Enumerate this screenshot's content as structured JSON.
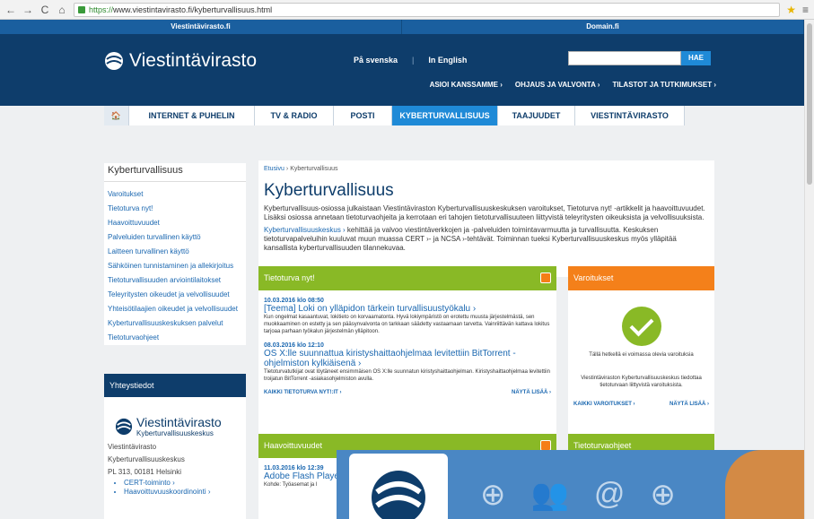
{
  "browser": {
    "url_https": "https://",
    "url_rest": "www.viestintavirasto.fi/kyberturvallisuus.html"
  },
  "toplinks": [
    "Viestintävirasto.fi",
    "Domain.fi"
  ],
  "header": {
    "logo": "Viestintävirasto",
    "lang_sv": "På svenska",
    "lang_en": "In English",
    "search_button": "HAE",
    "quick": [
      "ASIOI KANSSAMME ›",
      "OHJAUS JA VALVONTA ›",
      "TILASTOT JA TUTKIMUKSET ›"
    ]
  },
  "nav": [
    "INTERNET & PUHELIN",
    "TV & RADIO",
    "POSTI",
    "KYBERTURVALLISUUS",
    "TAAJUUDET",
    "VIESTINTÄVIRASTO"
  ],
  "sidebar": {
    "title": "Kyberturvallisuus",
    "items": [
      "Varoitukset",
      "Tietoturva nyt!",
      "Haavoittuvuudet",
      "Palveluiden turvallinen käyttö",
      "Laitteen turvallinen käyttö",
      "Sähköinen tunnistaminen ja allekirjoitus",
      "Tietoturvallisuuden arviointilaitokset",
      "Teleyritysten oikeudet ja velvollisuudet",
      "Yhteisötilaajien oikeudet ja velvollisuudet",
      "Kyberturvallisuuskeskuksen palvelut",
      "Tietoturvaohjeet"
    ]
  },
  "contact": {
    "title": "Yhteystiedot",
    "logo": "Viestintävirasto",
    "logo_sub": "Kyberturvallisuuskeskus",
    "line1": "Viestintävirasto",
    "line2": "Kyberturvallisuuskeskus",
    "line3": "PL 313, 00181 Helsinki",
    "links": [
      "CERT-toiminto ›",
      "Haavoittuvuuskoordinointi ›"
    ]
  },
  "main": {
    "crumb_home": "Etusivu",
    "crumb_current": "› Kyberturvallisuus",
    "title": "Kyberturvallisuus",
    "p1": "Kyberturvallisuus-osiossa julkaistaan Viestintäviraston Kyberturvallisuuskeskuksen varoitukset, Tietoturva nyt! -artikkelit ja haavoittuvuudet. Lisäksi osiossa annetaan tietoturvaohjeita ja kerrotaan eri tahojen tietoturvallisuuteen liittyvistä teleyritysten oikeuksista ja velvollisuuksista.",
    "p2_link": "Kyberturvallisuuskeskus ›",
    "p2": " kehittää ja valvoo viestintäverkkojen ja -palveluiden toimintavarmuutta ja turvallisuutta. Keskuksen tietoturvapalveluihin kuuluvat muun muassa CERT ›- ja NCSA ›-tehtävät. Toiminnan tueksi Kyberturvallisuuskeskus myös ylläpitää kansallista kyberturvallisuuden tilannekuvaa."
  },
  "news": {
    "title": "Tietoturva nyt!",
    "items": [
      {
        "date": "10.03.2016 klo 08:50",
        "title": "[Teema] Loki on ylläpidon tärkein turvallisuustyökalu ›",
        "desc": "Kun ongelmat kasaantuvat, lokitieto on korvaamatonta. Hyvä lokiympäristö on erotettu muusta järjestelmästä, sen muokkaaminen on estetty ja sen pääsynvalvonta on tarkkaan säädetty vastaamaan tarvetta. Vainriittävän kattava lokitus tarjoaa parhaan työkalun järjestelmän ylläpitoon."
      },
      {
        "date": "08.03.2016 klo 12:10",
        "title": "OS X:lle suunnattua kiristyshaittaohjelmaa levitettiin BitTorrent -ohjelmiston kylkiäisenä ›",
        "desc": "Tietoturvatutkijat ovat löytäneet ensimmäisen OS X:lle suunnatun kiristyshaittaohjelman. Kiristyshaittaohjelmaa levitettiin troijatun BitTorrent -asiakasohjelmiston avulla."
      }
    ],
    "all": "KAIKKI TIETOTURVA NYT!:IT ›",
    "more": "NÄYTÄ LISÄÄ ›"
  },
  "alerts": {
    "title": "Varoitukset",
    "status": "Tällä hetkellä ei voimassa olevia varoituksia",
    "desc": "Viestintäviraston Kyberturvallisuuskeskus tiedottaa tietoturvaan liittyvistä varoituksista.",
    "all": "KAIKKI VAROITUKSET ›",
    "more": "NÄYTÄ LISÄÄ ›"
  },
  "vuln": {
    "title": "Haavoittuvuudet",
    "date": "11.03.2016 klo 12:39",
    "item": "Adobe Flash Playeris",
    "kohde": "Kohde: Työasemat ja l"
  },
  "guides": {
    "title": "Tietoturvaohjeet"
  }
}
